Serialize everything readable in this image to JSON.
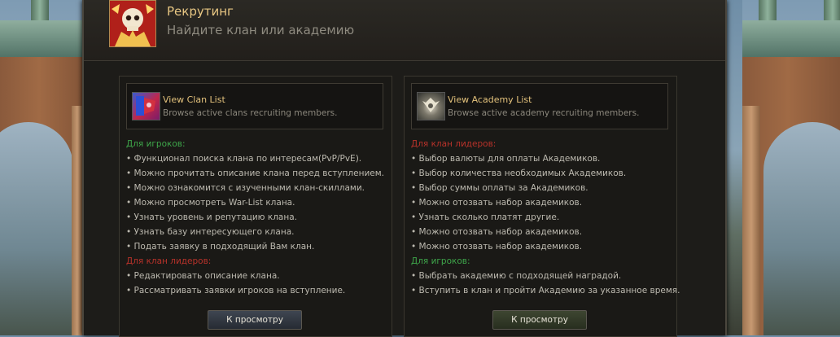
{
  "header": {
    "title": "Рекрутинг",
    "subtitle": "Найдите клан или академию",
    "icon": "skull-emblem-icon"
  },
  "clan_panel": {
    "title": "View Clan List",
    "description": "Browse active clans recruiting members.",
    "icon": "clan-banner-icon",
    "players_heading": "Для игроков:",
    "players_items": [
      "Функционал поиска клана по интересам(PvP/PvE).",
      "Можно прочитать описание клана перед вступлением.",
      "Можно ознакомится с изученными клан-скиллами.",
      "Можно просмотреть War-List клана.",
      "Узнать уровень и репутацию клана.",
      "Узнать базу интересующего клана.",
      "Подать заявку в подходящий Вам клан."
    ],
    "leaders_heading": "Для клан лидеров:",
    "leaders_items": [
      "Редактировать описание клана.",
      "Рассматривать заявки игроков на вступление."
    ],
    "button_label": "К просмотру"
  },
  "academy_panel": {
    "title": "View Academy List",
    "description": "Browse active academy recruiting members.",
    "icon": "academy-crest-icon",
    "leaders_heading": "Для клан лидеров:",
    "leaders_items": [
      "Выбор валюты для оплаты Академиков.",
      "Выбор количества необходимых Академиков.",
      "Выбор суммы оплаты за Академиков.",
      "Можно отозвать набор академиков.",
      "Узнать сколько платят другие.",
      "Можно отозвать набор академиков.",
      "Можно отозвать набор академиков."
    ],
    "players_heading": "Для игроков:",
    "players_items": [
      "Выбрать академию с подходящей наградой.",
      "Вступить в клан и пройти Академию за указанное время."
    ],
    "button_label": "К просмотру"
  },
  "colors": {
    "title_gold": "#e8c783",
    "players_green": "#3ea64a",
    "leaders_red": "#b8322a"
  }
}
